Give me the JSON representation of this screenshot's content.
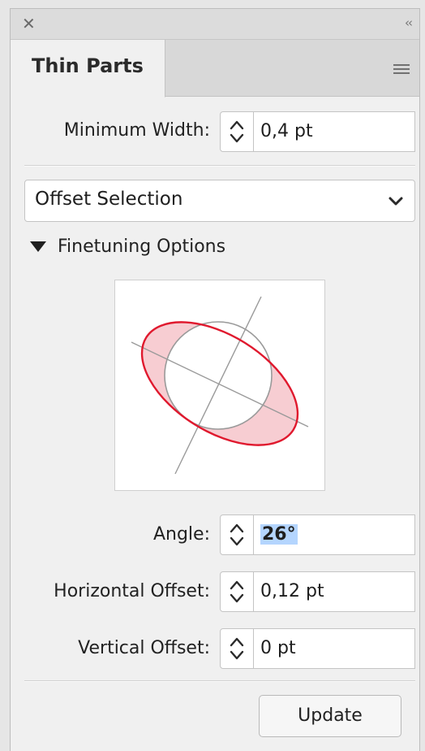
{
  "panel": {
    "tab_label": "Thin Parts",
    "close_icon": "close-icon",
    "collapse_icon": "collapse-icon",
    "menu_icon": "menu-icon"
  },
  "min_width": {
    "label": "Minimum Width:",
    "value": "0,4 pt"
  },
  "mode": {
    "selected": "Offset Selection"
  },
  "finetuning": {
    "label": "Finetuning Options"
  },
  "angle": {
    "label": "Angle:",
    "value": "26°"
  },
  "horizontal_offset": {
    "label": "Horizontal Offset:",
    "value": "0,12 pt"
  },
  "vertical_offset": {
    "label": "Vertical Offset:",
    "value": "0 pt"
  },
  "update_button": {
    "label": "Update"
  },
  "colors": {
    "ellipse_stroke": "#e0192e",
    "ellipse_fill": "#f7cdd2",
    "selection_highlight": "#b4d5fe"
  }
}
